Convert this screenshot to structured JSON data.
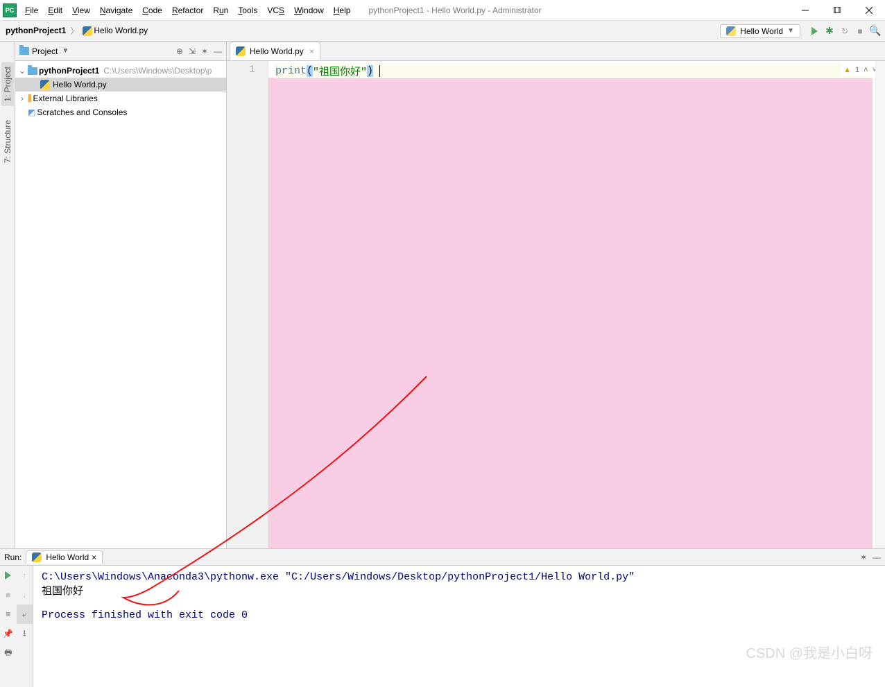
{
  "title": "pythonProject1 - Hello World.py - Administrator",
  "menu": [
    "File",
    "Edit",
    "View",
    "Navigate",
    "Code",
    "Refactor",
    "Run",
    "Tools",
    "VCS",
    "Window",
    "Help"
  ],
  "breadcrumb": {
    "project": "pythonProject1",
    "file": "Hello World.py"
  },
  "run_config": "Hello World",
  "project_panel": {
    "title": "Project",
    "root": "pythonProject1",
    "root_path": "C:\\Users\\Windows\\Desktop\\p",
    "file": "Hello World.py",
    "ext_libs": "External Libraries",
    "scratches": "Scratches and Consoles"
  },
  "vstripe": {
    "project": "1: Project",
    "structure": "7: Structure"
  },
  "editor": {
    "tab": "Hello World.py",
    "line_no": "1",
    "code": {
      "fn": "print",
      "str": "\"祖国你好\""
    },
    "inspection_count": "1"
  },
  "run": {
    "label": "Run:",
    "tab": "Hello World",
    "cmd": "C:\\Users\\Windows\\Anaconda3\\pythonw.exe \"C:/Users/Windows/Desktop/pythonProject1/Hello World.py\"",
    "out": "祖国你好",
    "exit": "Process finished with exit code 0"
  },
  "watermark": "CSDN @我是小白呀"
}
